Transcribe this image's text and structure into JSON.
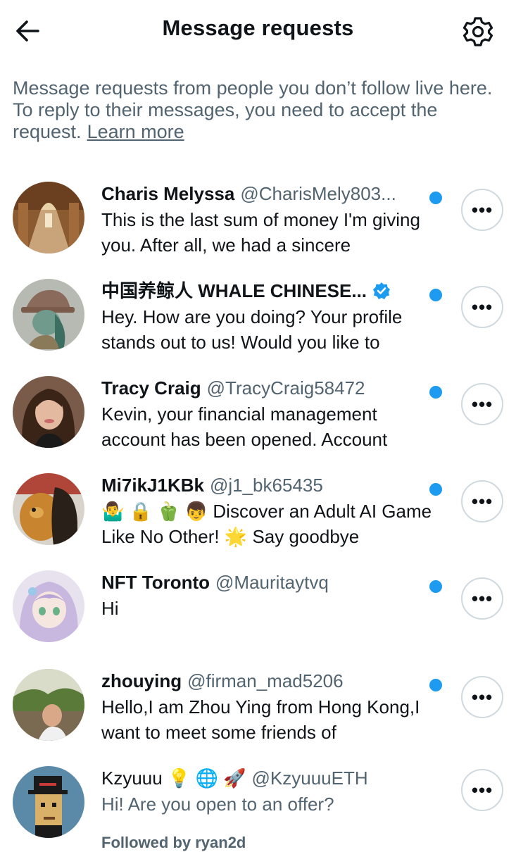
{
  "header": {
    "title": "Message requests",
    "back_icon": "arrow-left-icon",
    "settings_icon": "gear-icon"
  },
  "info": {
    "text": "Message requests from people you don’t follow live here. To reply to their messages, you need to accept the request.",
    "link": "Learn more"
  },
  "accent": "#1d9bf0",
  "conversations": [
    {
      "name": "Charis Melyssa",
      "handle": "@CharisMely803...",
      "message": "This is the last sum of money I'm giving you. After all, we had a sincere",
      "unread": true,
      "avatar": "hallway-photo"
    },
    {
      "name": "中国养鲸人 WHALE CHINESE...",
      "handle": "",
      "verified": true,
      "message": "Hey. How are you doing? Your profile stands out to us! Would you like to",
      "unread": true,
      "avatar": "illustrated-character"
    },
    {
      "name": "Tracy Craig",
      "handle": "@TracyCraig58472",
      "message": "Kevin, your financial management account has been opened. Account",
      "unread": true,
      "avatar": "woman-portrait"
    },
    {
      "name": "Mi7ikJ1KBk",
      "handle": "@j1_bk65435",
      "message": "🤷‍♂️ 🔒 🫑 👦 Discover an Adult AI Game Like No Other! 🌟  Say goodbye",
      "unread": true,
      "avatar": "dog-and-person"
    },
    {
      "name": "NFT Toronto",
      "handle": "@Mauritaytvq",
      "message": "Hi",
      "unread": true,
      "avatar": "anime-girl"
    },
    {
      "name": "zhouying",
      "handle": "@firman_mad5206",
      "message": "Hello,I am Zhou Ying from Hong Kong,I want to meet some friends of",
      "unread": true,
      "avatar": "outdoor-photo"
    },
    {
      "name": "Kzyuuu 💡 🌐 🚀",
      "handle": "@KzyuuuETH",
      "message": "Hi! Are you open to an offer?",
      "unread": false,
      "followed_by": "Followed by ryan2d",
      "avatar": "pixel-punk"
    }
  ],
  "more_label": "•••"
}
